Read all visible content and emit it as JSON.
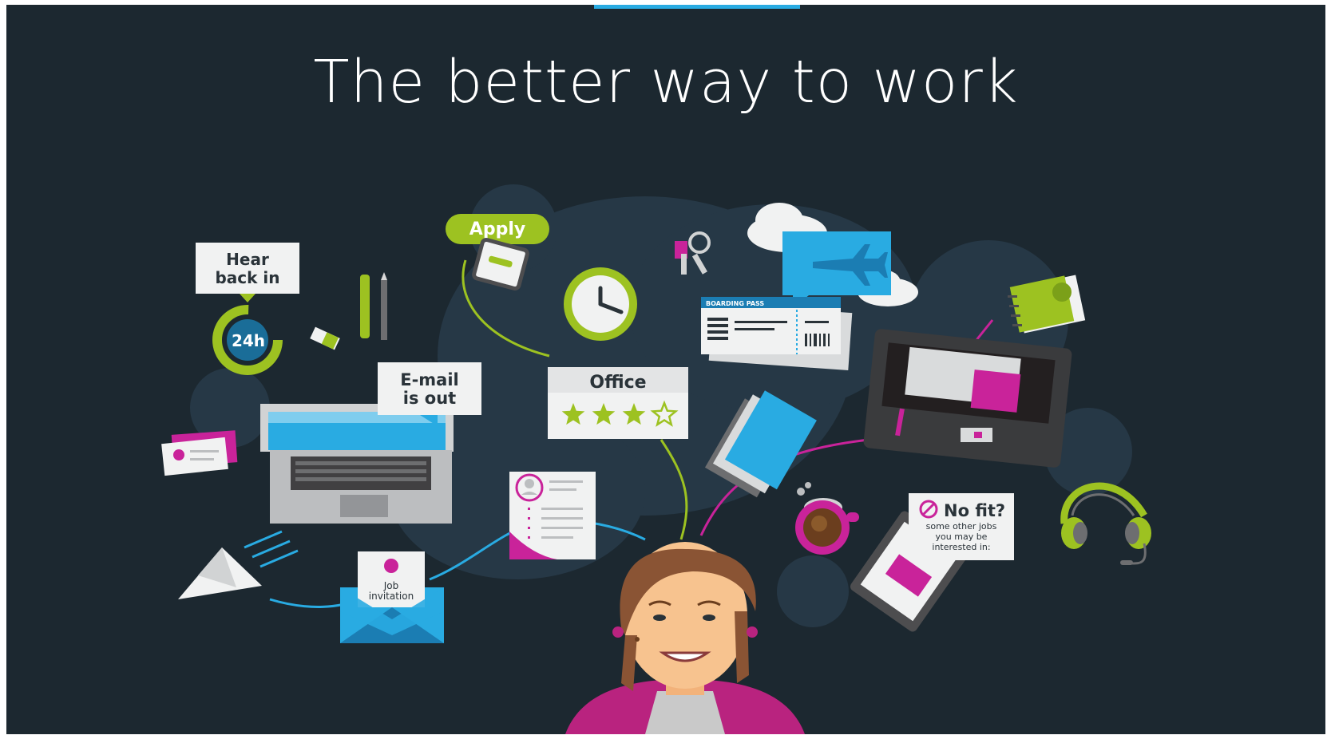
{
  "page": {
    "headline": "The better way to work"
  },
  "colors": {
    "background": "#1c2830",
    "accent_blue": "#29abe2",
    "accent_green": "#9dc221",
    "accent_magenta": "#c9239a",
    "blob": "#263846"
  },
  "illustration": {
    "hear_back_label_line1": "Hear",
    "hear_back_label_line2": "back in",
    "timer_label": "24h",
    "apply_label": "Apply",
    "email_label_line1": "E-mail",
    "email_label_line2": "is out",
    "office_label": "Office",
    "office_rating": 3,
    "office_rating_max": 4,
    "boarding_pass_label": "BOARDING PASS",
    "job_invitation_line1": "Job",
    "job_invitation_line2": "invitation",
    "no_fit_title": "No fit?",
    "no_fit_line1": "some other jobs",
    "no_fit_line2": "you may be",
    "no_fit_line3": "interested in:"
  },
  "icons": [
    "clock-icon",
    "keys-icon",
    "cloud-icon",
    "airplane-icon",
    "notebook-icon",
    "pens-icon",
    "eraser-icon",
    "laptop-icon",
    "business-cards-icon",
    "paper-plane-icon",
    "envelope-icon",
    "resume-icon",
    "folders-icon",
    "coffee-cup-icon",
    "printer-icon",
    "tablet-icon",
    "headphones-icon",
    "phone-icon",
    "woman-avatar"
  ]
}
